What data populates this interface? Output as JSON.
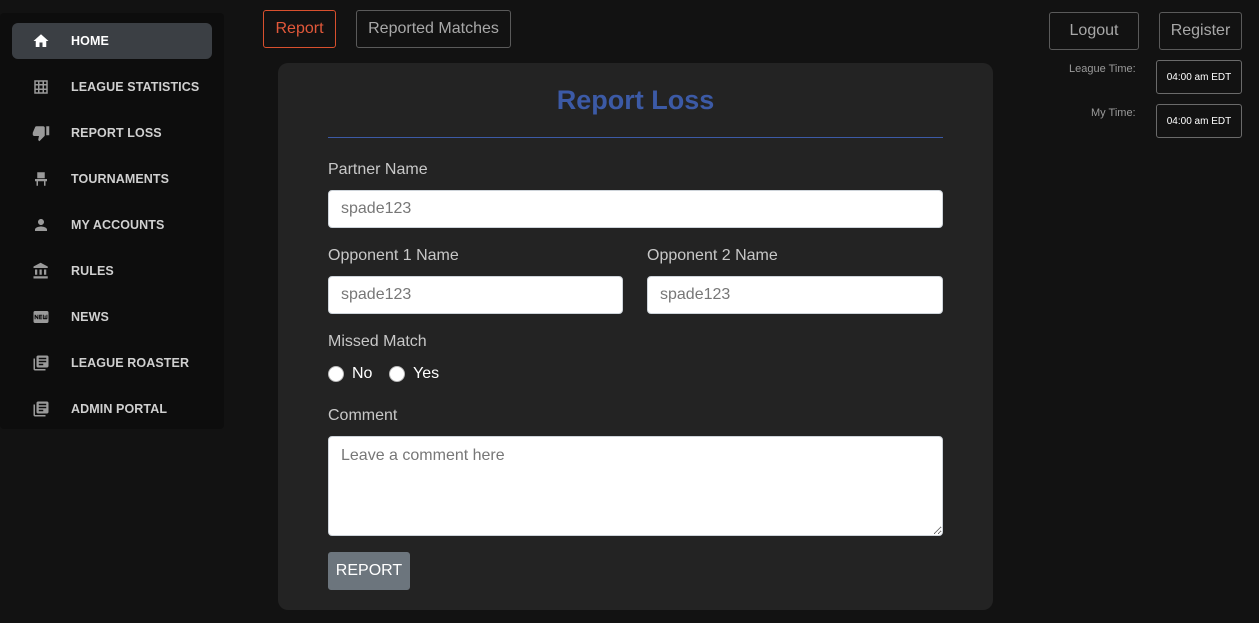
{
  "sidebar": {
    "items": [
      {
        "label": "HOME",
        "icon": "home-icon"
      },
      {
        "label": "LEAGUE STATISTICS",
        "icon": "grid-icon"
      },
      {
        "label": "REPORT LOSS",
        "icon": "thumbs-down-icon"
      },
      {
        "label": "TOURNAMENTS",
        "icon": "chair-icon"
      },
      {
        "label": "MY ACCOUNTS",
        "icon": "person-icon"
      },
      {
        "label": "RULES",
        "icon": "bank-icon"
      },
      {
        "label": "NEWS",
        "icon": "new-badge-icon"
      },
      {
        "label": "LEAGUE ROASTER",
        "icon": "library-books-icon"
      },
      {
        "label": "ADMIN PORTAL",
        "icon": "library-books-icon"
      }
    ],
    "active_index": 0
  },
  "top_tabs": {
    "report_label": "Report",
    "reported_matches_label": "Reported Matches"
  },
  "auth": {
    "logout_label": "Logout",
    "register_label": "Register"
  },
  "time": {
    "league_time_label": "League Time:",
    "league_time_value": "04:00 am EDT",
    "my_time_label": "My Time:",
    "my_time_value": "04:00 am EDT"
  },
  "form": {
    "title": "Report Loss",
    "partner_label": "Partner Name",
    "partner_placeholder": "spade123",
    "opponent1_label": "Opponent 1 Name",
    "opponent1_placeholder": "spade123",
    "opponent2_label": "Opponent 2 Name",
    "opponent2_placeholder": "spade123",
    "missed_match_label": "Missed Match",
    "missed_match_options": [
      "No",
      "Yes"
    ],
    "comment_label": "Comment",
    "comment_placeholder": "Leave a comment here",
    "submit_label": "REPORT"
  },
  "colors": {
    "accent_blue": "#3c5aa6",
    "report_tab": "#e2583a",
    "submit_bg": "#6c757d"
  }
}
